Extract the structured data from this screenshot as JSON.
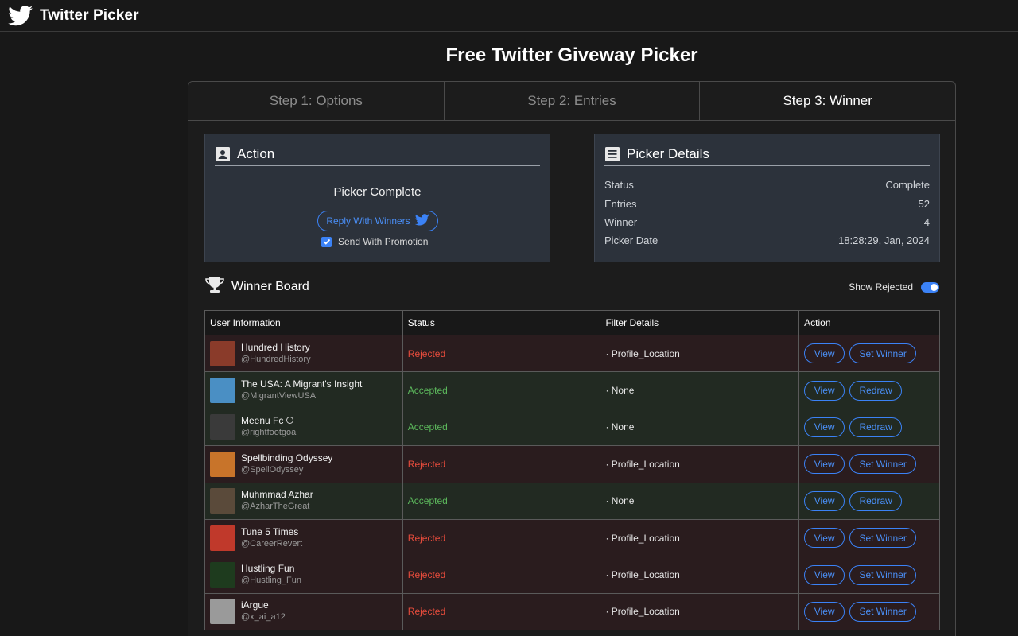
{
  "app": {
    "name": "Twitter Picker",
    "page_title": "Free Twitter Giveway Picker",
    "accent": "#3b82f6"
  },
  "tabs": [
    {
      "label": "Step 1: Options"
    },
    {
      "label": "Step 2: Entries"
    },
    {
      "label": "Step 3: Winner"
    }
  ],
  "action_panel": {
    "title": "Action",
    "icon": "contact-card-icon",
    "status_text": "Picker Complete",
    "reply_button": "Reply With Winners",
    "promo_label": "Send With Promotion",
    "promo_checked": true
  },
  "details_panel": {
    "title": "Picker Details",
    "icon": "document-list-icon",
    "rows": [
      {
        "label": "Status",
        "value": "Complete"
      },
      {
        "label": "Entries",
        "value": "52"
      },
      {
        "label": "Winner",
        "value": "4"
      },
      {
        "label": "Picker Date",
        "value": "18:28:29, Jan, 2024"
      }
    ]
  },
  "winner_board": {
    "title": "Winner Board",
    "icon": "trophy-icon",
    "show_rejected_label": "Show Rejected",
    "show_rejected": true,
    "columns": [
      "User Information",
      "Status",
      "Filter Details",
      "Action"
    ],
    "rows": [
      {
        "name": "Hundred History",
        "handle": "@HundredHistory",
        "status": "Rejected",
        "filter": "· Profile_Location",
        "view": "View",
        "secondary": "Set Winner",
        "avatar_color": "#8a3b2a"
      },
      {
        "name": "The USA: A Migrant's Insight",
        "handle": "@MigrantViewUSA",
        "status": "Accepted",
        "filter": "· None",
        "view": "View",
        "secondary": "Redraw",
        "avatar_color": "#4a8fc4"
      },
      {
        "name": "Meenu Fc",
        "handle": "@rightfootgoal",
        "status": "Accepted",
        "filter": "· None",
        "view": "View",
        "secondary": "Redraw",
        "avatar_color": "#3a3a3a"
      },
      {
        "name": "Spellbinding Odyssey",
        "handle": "@SpellOdyssey",
        "status": "Rejected",
        "filter": "· Profile_Location",
        "view": "View",
        "secondary": "Set Winner",
        "avatar_color": "#c8742a"
      },
      {
        "name": "Muhmmad Azhar",
        "handle": "@AzharTheGreat",
        "status": "Accepted",
        "filter": "· None",
        "view": "View",
        "secondary": "Redraw",
        "avatar_color": "#5a4a3a"
      },
      {
        "name": "Tune 5 Times",
        "handle": "@CareerRevert",
        "status": "Rejected",
        "filter": "· Profile_Location",
        "view": "View",
        "secondary": "Set Winner",
        "avatar_color": "#c0392b"
      },
      {
        "name": "Hustling Fun",
        "handle": "@Hustling_Fun",
        "status": "Rejected",
        "filter": "· Profile_Location",
        "view": "View",
        "secondary": "Set Winner",
        "avatar_color": "#1e3b1e"
      },
      {
        "name": "iArgue",
        "handle": "@x_ai_a12",
        "status": "Rejected",
        "filter": "· Profile_Location",
        "view": "View",
        "secondary": "Set Winner",
        "avatar_color": "#9a9a9a"
      }
    ]
  }
}
